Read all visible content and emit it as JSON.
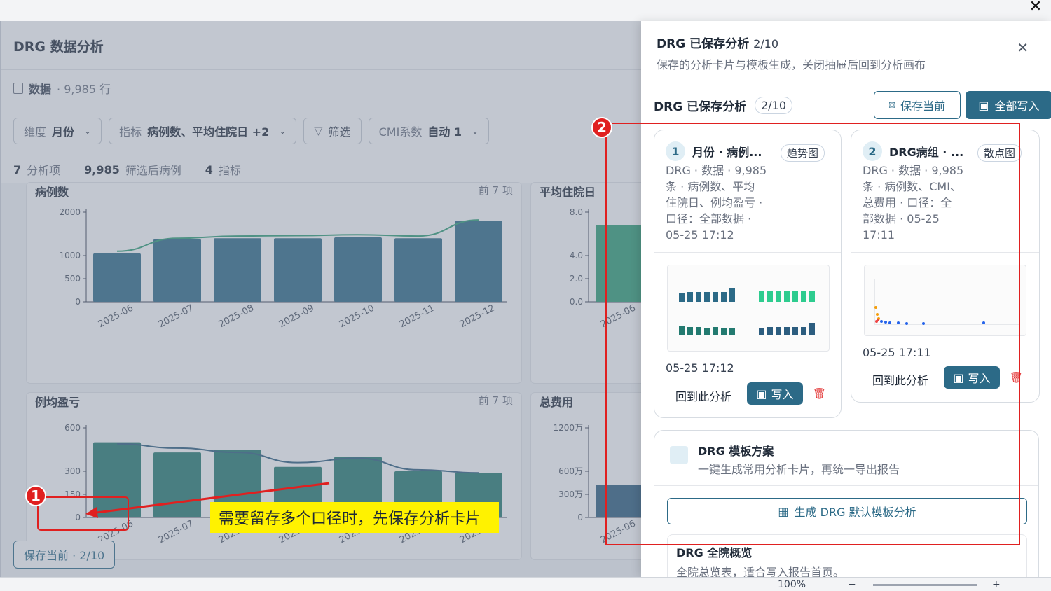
{
  "window": {
    "close_glyph": "✕"
  },
  "app": {
    "title": "DRG 数据分析",
    "data_label": "数据",
    "data_count": "· 9,985 行",
    "controls": [
      {
        "key": "维度",
        "value": "月份"
      },
      {
        "key": "指标",
        "value": "病例数、平均住院日 +2"
      },
      {
        "key": "",
        "value": "筛选"
      },
      {
        "key": "CMI系数",
        "value": "自动 1"
      }
    ],
    "summary": {
      "items_num": "7",
      "items_label": "分析项",
      "cases_num": "9,985",
      "cases_label": "筛选后病例",
      "metrics_num": "4",
      "metrics_label": "指标"
    },
    "save_current": "保存当前 · 2/10"
  },
  "chart_data": [
    {
      "type": "bar",
      "title": "病例数",
      "top_label": "前 7 项",
      "categories": [
        "2025-06",
        "2025-07",
        "2025-08",
        "2025-09",
        "2025-10",
        "2025-11",
        "2025-12"
      ],
      "values": [
        1050,
        1380,
        1400,
        1400,
        1420,
        1400,
        1800
      ],
      "line_values": [
        1100,
        1400,
        1450,
        1460,
        1480,
        1450,
        1820
      ],
      "yticks": [
        "2000",
        "1000",
        "500",
        "0"
      ],
      "ylim": [
        0,
        2000
      ],
      "color": "#2c6a87",
      "line_color": "#2e9e75"
    },
    {
      "type": "bar",
      "title": "平均住院日",
      "yticks": [
        "8.0",
        "4.0",
        "2.0",
        "0.0"
      ],
      "categories": [
        "2025-06"
      ],
      "values": [
        6.8
      ],
      "color": "#2e9e75"
    },
    {
      "type": "bar",
      "title": "例均盈亏",
      "top_label": "前 7 项",
      "categories": [
        "2025-06",
        "2025-07",
        "2025-08",
        "2025-09",
        "2025-10",
        "2025-11",
        "2025-12"
      ],
      "values": [
        500,
        430,
        450,
        330,
        400,
        300,
        290
      ],
      "line_values": [
        490,
        460,
        430,
        360,
        390,
        310,
        290
      ],
      "yticks": [
        "600",
        "300",
        "150",
        "0"
      ],
      "ylim": [
        0,
        600
      ],
      "color": "#237a70",
      "line_color": "#2c5d7f"
    },
    {
      "type": "bar",
      "title": "总费用",
      "yticks": [
        "1200万",
        "600万",
        "300万",
        "0"
      ],
      "categories": [
        "2025-06"
      ],
      "values": [
        420
      ],
      "color": "#2c5d7f"
    }
  ],
  "annotations": {
    "badge1": "1",
    "badge2": "2",
    "callout": "需要留存多个口径时，先保存分析卡片"
  },
  "drawer": {
    "title": "DRG 已保存分析",
    "count": "2/10",
    "subtitle": "保存的分析卡片与模板生成，关闭抽屉后回到分析画布",
    "bar_title": "DRG 已保存分析",
    "bar_count": "2/10",
    "save_current": "保存当前",
    "write_all": "全部写入",
    "cards": [
      {
        "num": "1",
        "title": "月份 · 病例...",
        "tag": "趋势图",
        "desc": [
          "DRG · 数据 · 9,985",
          "条 · 病例数、平均",
          "住院日、例均盈亏 ·",
          "口径：全部数据 ·",
          "05-25 17:12"
        ],
        "time": "05-25 17:12",
        "back": "回到此分析",
        "write": "写入"
      },
      {
        "num": "2",
        "title": "DRG病组 · ...",
        "tag": "散点图",
        "desc": [
          "DRG · 数据 · 9,985",
          "条 · 病例数、CMI、",
          "总费用 · 口径：全",
          "部数据 · 05-25",
          "17:11"
        ],
        "time": "05-25 17:11",
        "back": "回到此分析",
        "write": "写入"
      }
    ],
    "template": {
      "title": "DRG 模板方案",
      "subtitle": "一键生成常用分析卡片，再统一导出报告",
      "generate": "生成 DRG 默认模板分析",
      "item_title": "DRG 全院概览",
      "item_sub": "全院总览表，适合写入报告首页。"
    }
  },
  "statusbar": {
    "zoom": "100%"
  }
}
